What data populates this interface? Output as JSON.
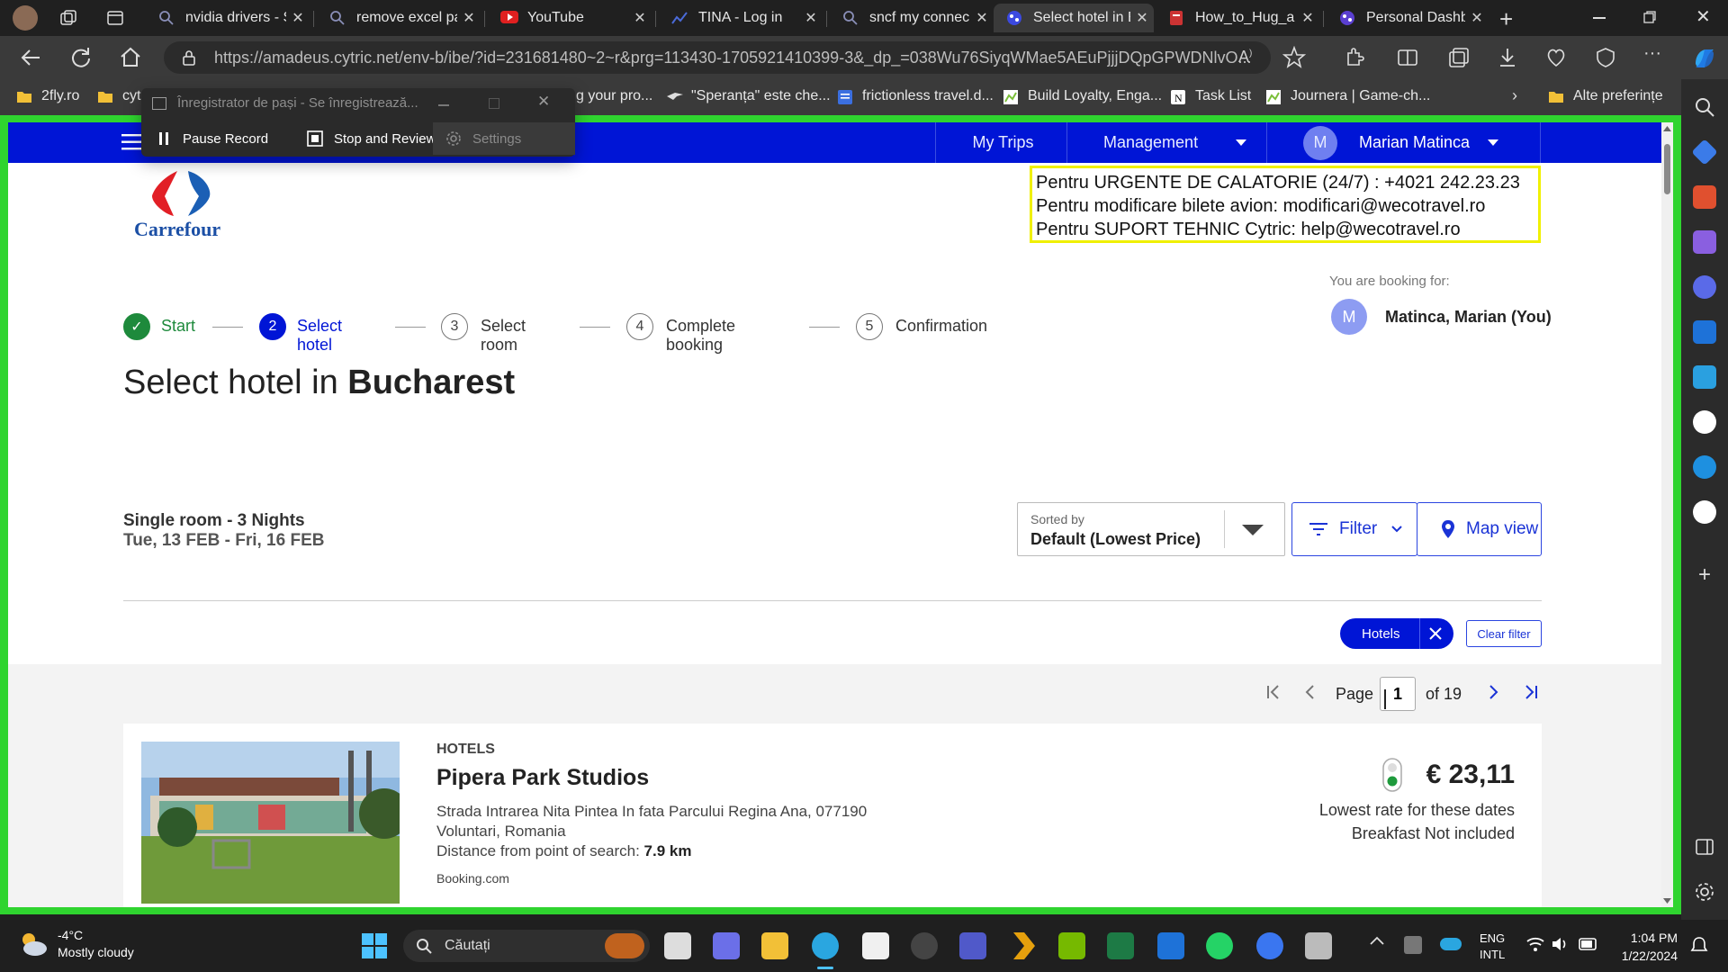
{
  "browser": {
    "tabs": [
      {
        "label": "nvidia drivers - S",
        "icon": "search-icon"
      },
      {
        "label": "remove excel pa",
        "icon": "search-icon"
      },
      {
        "label": "YouTube",
        "icon": "youtube-icon"
      },
      {
        "label": "TINA - Log in",
        "icon": "chart-icon"
      },
      {
        "label": "sncf my connec",
        "icon": "search-icon"
      },
      {
        "label": "Select hotel in B",
        "icon": "cytric-icon",
        "active": true
      },
      {
        "label": "How_to_Hug_a",
        "icon": "document-icon"
      },
      {
        "label": "Personal Dashb",
        "icon": "cytric-icon"
      }
    ],
    "url": "https://amadeus.cytric.net/env-b/ibe/?id=231681480~2~r&prg=113430-1705921410399-3&_dp_=038Wu76SiyqWMae5AEuPjjjDQpGPWDNlvO...",
    "favorites": [
      {
        "label": "2fly.ro"
      },
      {
        "label": "cyt"
      },
      {
        "label": "g your pro..."
      },
      {
        "label": "\"Speranța\" este che..."
      },
      {
        "label": "frictionless travel.d..."
      },
      {
        "label": "Build Loyalty, Enga..."
      },
      {
        "label": "Task List"
      },
      {
        "label": "Journera | Game-ch..."
      }
    ],
    "favorites_other": "Alte preferințe"
  },
  "recorder": {
    "title": "Înregistrator de pași - Se înregistrează...",
    "pause": "Pause Record",
    "stop": "Stop and Review",
    "settings": "Settings"
  },
  "topnav": {
    "my_trips": "My Trips",
    "management": "Management",
    "user_initial": "M",
    "user_name": "Marian Matinca"
  },
  "brand": {
    "name": "Carrefour"
  },
  "notice": {
    "line1": "Pentru URGENTE DE CALATORIE (24/7) : +4021 242.23.23",
    "line2": "Pentru modificare bilete avion:  modificari@wecotravel.ro",
    "line3": "Pentru SUPORT TEHNIC Cytric:  help@wecotravel.ro"
  },
  "booking_for": {
    "label": "You are booking for:",
    "initial": "M",
    "name": "Matinca, Marian (You)"
  },
  "stepper": [
    {
      "num": "✓",
      "label": "Start",
      "state": "done"
    },
    {
      "num": "2",
      "label": "Select hotel",
      "state": "active"
    },
    {
      "num": "3",
      "label": "Select room",
      "state": "todo"
    },
    {
      "num": "4",
      "label": "Complete booking",
      "state": "todo"
    },
    {
      "num": "5",
      "label": "Confirmation",
      "state": "todo"
    }
  ],
  "heading": {
    "prefix": "Select hotel in ",
    "city": "Bucharest"
  },
  "stay": {
    "room": "Single room - 3 Nights",
    "dates": "Tue, 13 FEB - Fri, 16 FEB"
  },
  "sort": {
    "label": "Sorted by",
    "value": "Default (Lowest Price)"
  },
  "filter_btn": "Filter",
  "map_btn": "Map view",
  "chips": {
    "hotels": "Hotels",
    "clear": "Clear filter"
  },
  "pagination": {
    "page_label": "Page",
    "page": "1",
    "of": "of 19"
  },
  "hotel": {
    "category": "HOTELS",
    "name": "Pipera Park Studios",
    "address1": "Strada Intrarea Nita Pintea In fata Parcului Regina Ana, 077190",
    "address2": "Voluntari, Romania",
    "distance_label": "Distance from point of search: ",
    "distance": "7.9 km",
    "source": "Booking.com",
    "price": "€ 23,11",
    "rate_note": "Lowest rate for these dates",
    "breakfast": "Breakfast Not included"
  },
  "taskbar": {
    "weather_temp": "-4°C",
    "weather_desc": "Mostly cloudy",
    "search_placeholder": "Căutați",
    "lang1": "ENG",
    "lang2": "INTL",
    "time": "1:04 PM",
    "date": "1/22/2024"
  },
  "colors": {
    "brand_blue": "#0015d6",
    "accent": "#1a33d6",
    "frame_green": "#2fd42f",
    "notice_border": "#f0f000",
    "done_green": "#1e8a3c"
  }
}
